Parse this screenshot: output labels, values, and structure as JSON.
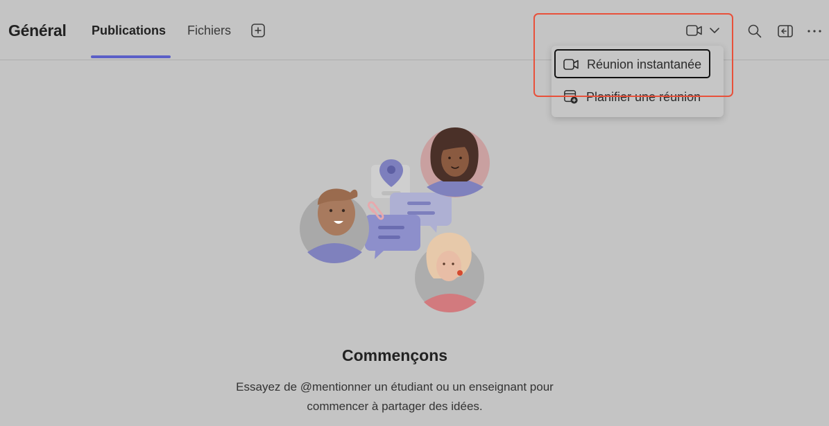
{
  "header": {
    "title": "Général",
    "tabs": [
      {
        "label": "Publications",
        "active": true
      },
      {
        "label": "Fichiers",
        "active": false
      }
    ],
    "icons": {
      "add_tab": "plus-square-icon",
      "video": "video-camera-icon",
      "dropdown": "chevron-down-icon",
      "search": "search-icon",
      "panel": "side-panel-icon",
      "more": "more-horizontal-icon"
    }
  },
  "meeting_menu": {
    "items": [
      {
        "label": "Réunion instantanée",
        "icon": "video-camera-icon",
        "focused": true
      },
      {
        "label": "Planifier une réunion",
        "icon": "calendar-add-icon",
        "focused": false
      }
    ]
  },
  "empty_state": {
    "title": "Commençons",
    "description": "Essayez de @mentionner un étudiant ou un enseignant pour commencer à partager des idées."
  },
  "colors": {
    "accent": "#5b5fc7",
    "highlight": "#e8503a",
    "background": "#c4c4c4"
  }
}
